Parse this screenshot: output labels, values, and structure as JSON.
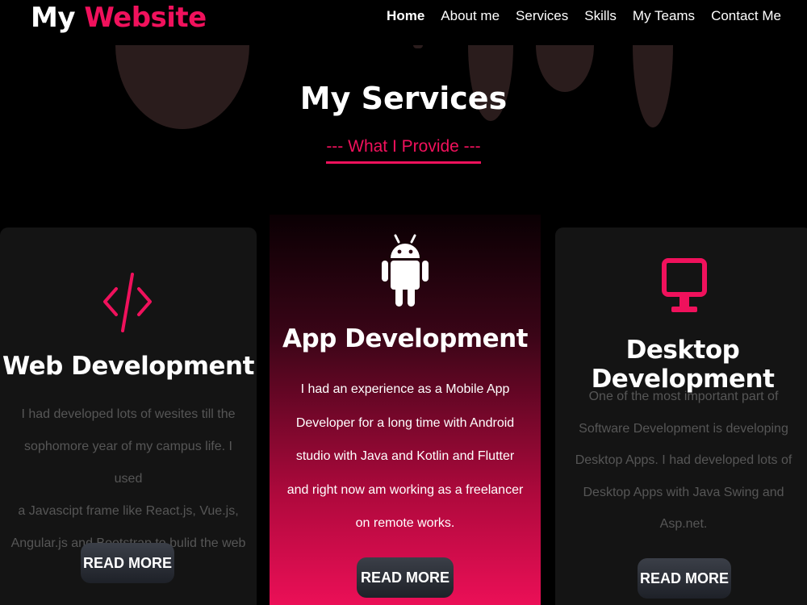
{
  "header": {
    "logo_main": "My",
    "logo_accent": "Website",
    "nav": [
      {
        "label": "Home"
      },
      {
        "label": "About me"
      },
      {
        "label": "Services"
      },
      {
        "label": "Skills"
      },
      {
        "label": "My Teams"
      },
      {
        "label": "Contact Me"
      }
    ]
  },
  "services": {
    "title": "My Services",
    "subtitle": "--- What I Provide ---",
    "cards": [
      {
        "icon": "code-icon",
        "title": "Web Development",
        "lines": [
          "I had developed lots of wesites till the",
          "sophomore year of my campus life. I used",
          "a Javascipt frame like React.js, Vue.js,",
          "Angular.js and Bootstrap to bulid the web"
        ],
        "button": "READ MORE"
      },
      {
        "icon": "android-icon",
        "title": "App Development",
        "lines": [
          "I had an experience as a Mobile App",
          "Developer for a long time with Android",
          "studio with Java and Kotlin and Flutter",
          "and right now am working as a freelancer",
          "on remote works."
        ],
        "button": "READ MORE"
      },
      {
        "icon": "desktop-icon",
        "title": "Desktop Development",
        "lines": [
          "One of the most important part of",
          "Software Development is developing",
          "Desktop Apps. I had developed lots of",
          "Desktop Apps with Java Swing and",
          "Asp.net."
        ],
        "button": "READ MORE"
      }
    ]
  },
  "colors": {
    "accent": "#f0115c",
    "background": "#000000",
    "card": "#141414"
  }
}
